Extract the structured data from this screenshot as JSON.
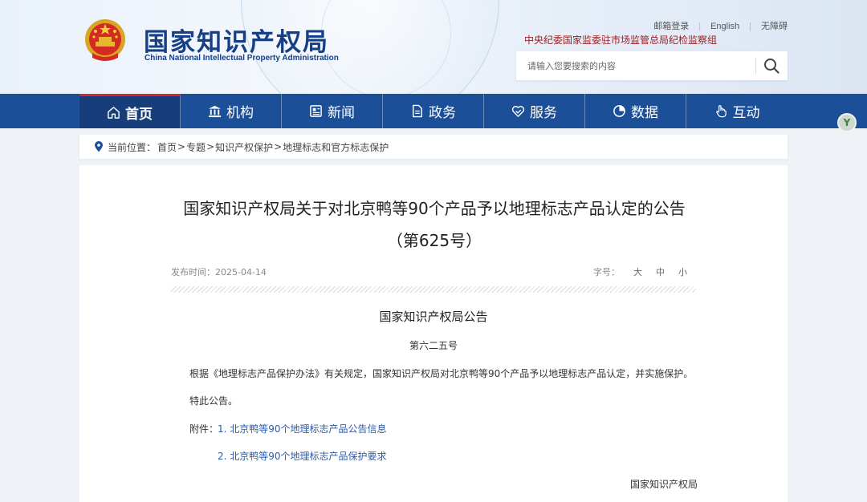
{
  "header": {
    "logo_cn": "国家知识产权局",
    "logo_en": "China National Intellectual Property Administration",
    "top_links": [
      "邮箱登录",
      "English",
      "无障碍"
    ],
    "jijian": "中央纪委国家监委驻市场监管总局纪检监察组",
    "search_placeholder": "请输入您要搜索的内容"
  },
  "nav": {
    "items": [
      {
        "label": "首页",
        "icon": "home-icon"
      },
      {
        "label": "机构",
        "icon": "institution-icon"
      },
      {
        "label": "新闻",
        "icon": "news-icon"
      },
      {
        "label": "政务",
        "icon": "document-icon"
      },
      {
        "label": "服务",
        "icon": "service-icon"
      },
      {
        "label": "数据",
        "icon": "pie-chart-icon"
      },
      {
        "label": "互动",
        "icon": "hand-pointer-icon"
      }
    ],
    "active_index": 0
  },
  "breadcrumb": {
    "label": "当前位置：",
    "items": [
      "首页",
      "专题",
      "知识产权保护",
      "地理标志和官方标志保护"
    ],
    "separator": ">"
  },
  "article": {
    "title": "国家知识产权局关于对北京鸭等90个产品予以地理标志产品认定的公告（第625号）",
    "publish_time": "发布时间：2025-04-14",
    "font_size_label": "字号：",
    "font_sizes": [
      "大",
      "中",
      "小"
    ],
    "doc_heading": "国家知识产权局公告",
    "doc_number": "第六二五号",
    "body": "根据《地理标志产品保护办法》有关规定，国家知识产权局对北京鸭等90个产品予以地理标志产品认定，并实施保护。",
    "note": "特此公告。",
    "attachment_label": "附件：",
    "attachments": [
      "1. 北京鸭等90个地理标志产品公告信息",
      "2. 北京鸭等90个地理标志产品保护要求"
    ],
    "signer": "国家知识产权局"
  },
  "colors": {
    "nav_bg": "#1b4f98",
    "nav_active": "#173e7b",
    "active_accent": "#d8262f",
    "brand_text": "#173f86",
    "link": "#2b5cab",
    "jijian_text": "#9b1b1b"
  }
}
